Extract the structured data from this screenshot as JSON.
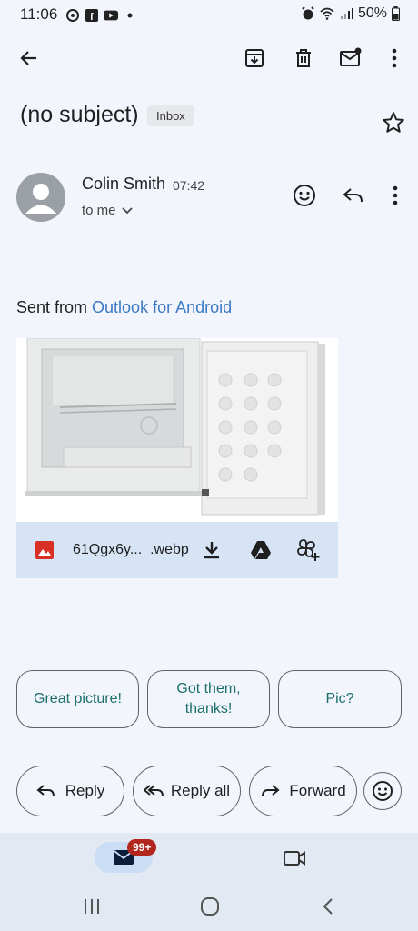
{
  "status_bar": {
    "time": "11:06",
    "battery": "50%"
  },
  "toolbar": {
    "back": "back-arrow-icon",
    "archive": "archive-icon",
    "delete": "delete-icon",
    "mark_unread": "mark-unread-icon",
    "more": "more-vert-icon"
  },
  "email": {
    "subject": "(no subject)",
    "label": "Inbox",
    "sender": "Colin Smith",
    "time": "07:42",
    "recipient": "to me",
    "body_prefix": "Sent from ",
    "body_link": "Outlook for Android"
  },
  "attachment": {
    "filename": "61Qgx6y..._.webp"
  },
  "smart_replies": [
    {
      "label": "Great picture!"
    },
    {
      "label": "Got them, thanks!"
    },
    {
      "label": "Pic?"
    }
  ],
  "actions": {
    "reply": "Reply",
    "reply_all": "Reply all",
    "forward": "Forward"
  },
  "bottom_nav": {
    "mail_badge": "99+"
  },
  "colors": {
    "accent_link": "#3b78c3",
    "chip_text": "#1b6e6a",
    "badge": "#b3261e",
    "background": "#f2f6fc"
  }
}
